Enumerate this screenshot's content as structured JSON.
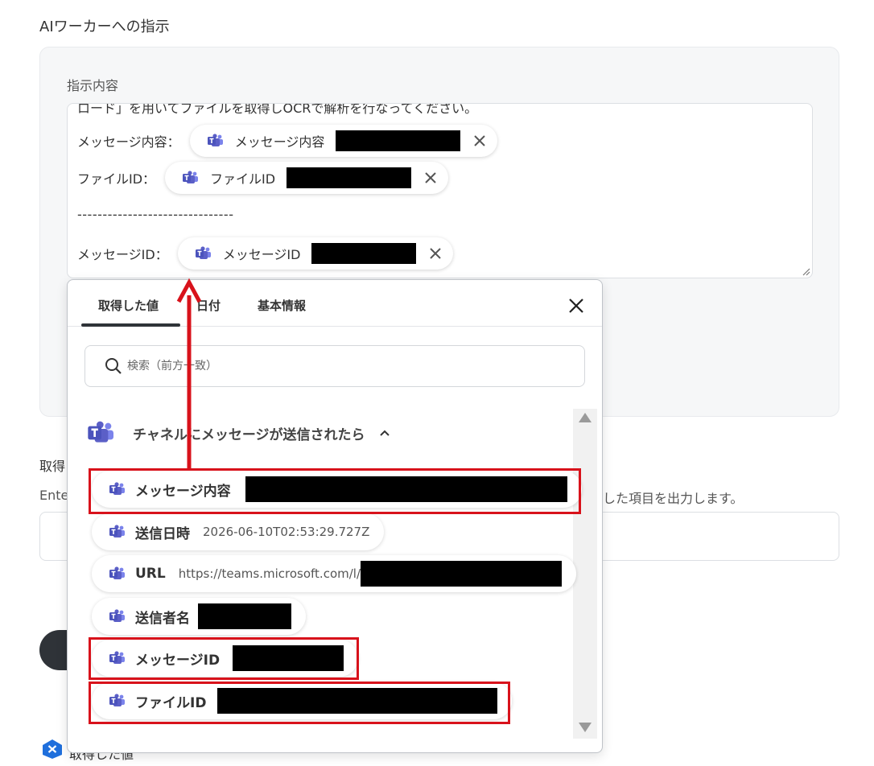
{
  "section_title": "AIワーカーへの指示",
  "panel": {
    "label": "指示内容",
    "clipped_line": "ロード」を用いてファイルを取得しOCRで解析を行なってください。",
    "rows": [
      {
        "label": "メッセージ内容：",
        "chip": "メッセージ内容"
      },
      {
        "label": "ファイルID：",
        "chip": "ファイルID"
      },
      {
        "label": "メッセージID：",
        "chip": "メッセージID"
      }
    ],
    "divider": "-------------------------------"
  },
  "background": {
    "label_partial": "取得",
    "text_left": "Ente",
    "text_right": "した項目を出力します。",
    "bottom_text": "取得した値"
  },
  "popup": {
    "tabs": [
      "取得した値",
      "日付",
      "基本情報"
    ],
    "active_tab": "取得した値",
    "search_placeholder": "検索（前方一致）",
    "group_label": "チャネルにメッセージが送信されたら",
    "items": [
      {
        "label": "メッセージ内容",
        "value": ""
      },
      {
        "label": "送信日時",
        "value": "2026-06-10T02:53:29.727Z"
      },
      {
        "label": "URL",
        "value": "https://teams.microsoft.com/l/"
      },
      {
        "label": "送信者名",
        "value": ""
      },
      {
        "label": "メッセージID",
        "value": ""
      },
      {
        "label": "ファイルID",
        "value": ""
      }
    ]
  },
  "colors": {
    "teams": "#5b5fc7",
    "highlight": "#d8121b",
    "badge": "#1f6fdc"
  },
  "icons": {
    "chip": "teams-icon",
    "remove": "close-icon",
    "search": "search-icon",
    "group_toggle": "chevron-up-icon"
  }
}
